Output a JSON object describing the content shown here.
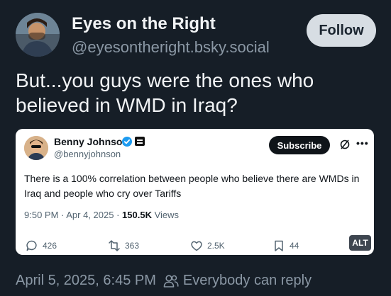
{
  "post": {
    "author_name": "Eyes on the Right",
    "author_handle": "@eyesontheright.bsky.social",
    "follow_label": "Follow",
    "text": "But...you guys were the ones who believed in WMD in Iraq?",
    "timestamp": "April 5, 2025, 6:45 PM",
    "reply_setting": "Everybody can reply"
  },
  "embed": {
    "author_name": "Benny Johnson",
    "author_handle": "@bennyjohnson",
    "subscribe_label": "Subscribe",
    "text": "There is a 100% correlation between people who believe there are WMDs in Iraq and people who cry over Tariffs",
    "time": "9:50 PM · Apr 4, 2025 · ",
    "views_count": "150.5K",
    "views_label": " Views",
    "replies": "426",
    "reposts": "363",
    "likes": "2.5K",
    "bookmarks": "44",
    "alt_label": "ALT"
  },
  "colors": {
    "background": "#161e27",
    "verified": "#1d9bf0",
    "muted": "#8b98a5"
  },
  "icons": [
    "avatar",
    "verified-badge-icon",
    "org-badge-icon",
    "grok-icon",
    "more-icon",
    "reply-icon",
    "repost-icon",
    "like-icon",
    "bookmark-icon",
    "people-icon"
  ]
}
